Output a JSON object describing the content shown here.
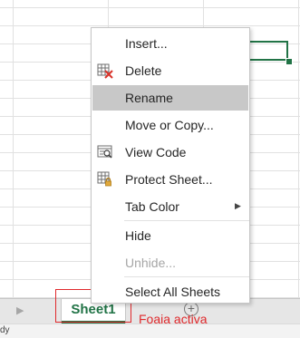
{
  "menu": {
    "items": [
      {
        "label": "Insert..."
      },
      {
        "label": "Delete"
      },
      {
        "label": "Rename"
      },
      {
        "label": "Move or Copy..."
      },
      {
        "label": "View Code"
      },
      {
        "label": "Protect Sheet..."
      },
      {
        "label": "Tab Color"
      },
      {
        "label": "Hide"
      },
      {
        "label": "Unhide..."
      },
      {
        "label": "Select All Sheets"
      }
    ]
  },
  "tabs": {
    "active_sheet": "Sheet1",
    "add_icon": "plus-circle-icon"
  },
  "status": {
    "text": "dy"
  },
  "annotation": {
    "text": "Foaia activa"
  },
  "colors": {
    "accent": "#217346",
    "annotation": "#e0292c",
    "hover": "#c8c8c8"
  }
}
